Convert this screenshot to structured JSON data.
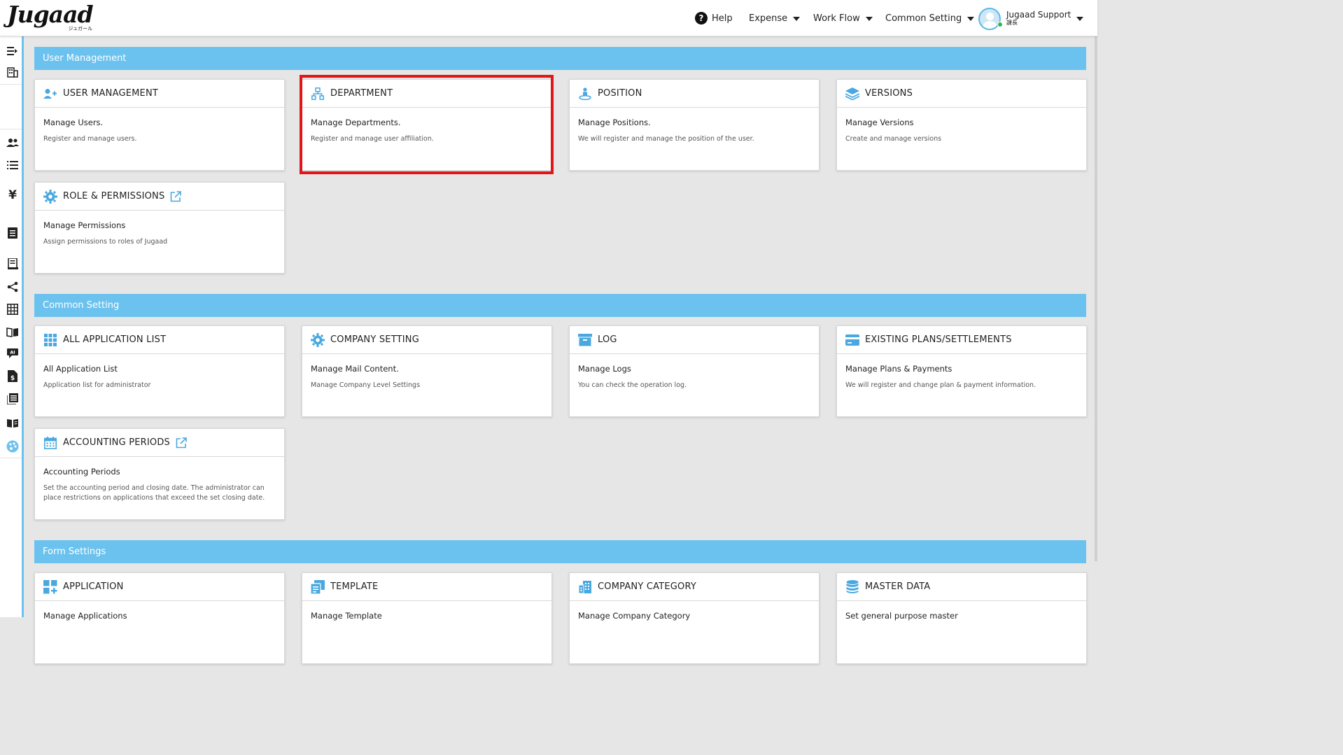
{
  "header": {
    "logo_text": "Jugaad",
    "logo_sub": "ジュガール",
    "nav": {
      "help": "Help",
      "expense": "Expense",
      "workflow": "Work Flow",
      "common_setting": "Common Setting"
    },
    "user": {
      "name": "Jugaad Support",
      "role": "課長"
    }
  },
  "sections": {
    "user_management": {
      "title": "User Management",
      "cards": {
        "user_management": {
          "title": "USER MANAGEMENT",
          "main": "Manage Users.",
          "desc": "Register and manage users."
        },
        "department": {
          "title": "DEPARTMENT",
          "main": "Manage Departments.",
          "desc": "Register and manage user affiliation."
        },
        "position": {
          "title": "POSITION",
          "main": "Manage Positions.",
          "desc": "We will register and manage the position of the user."
        },
        "versions": {
          "title": "VERSIONS",
          "main": "Manage Versions",
          "desc": "Create and manage versions"
        },
        "roles": {
          "title": "ROLE & PERMISSIONS",
          "main": "Manage Permissions",
          "desc": "Assign permissions to roles of Jugaad"
        }
      }
    },
    "common_setting": {
      "title": "Common Setting",
      "cards": {
        "all_apps": {
          "title": "ALL APPLICATION LIST",
          "main": "All Application List",
          "desc": "Application list for administrator"
        },
        "company_setting": {
          "title": "COMPANY SETTING",
          "main": "Manage Mail Content.",
          "desc": "Manage Company Level Settings"
        },
        "log": {
          "title": "LOG",
          "main": "Manage Logs",
          "desc": "You can check the operation log."
        },
        "plans": {
          "title": "EXISTING PLANS/SETTLEMENTS",
          "main": "Manage Plans & Payments",
          "desc": "We will register and change plan & payment information."
        },
        "accounting": {
          "title": "ACCOUNTING PERIODS",
          "main": "Accounting Periods",
          "desc": "Set the accounting period and closing date. The administrator can place restrictions on applications that exceed the set closing date."
        }
      }
    },
    "form_settings": {
      "title": "Form Settings",
      "cards": {
        "application": {
          "title": "APPLICATION",
          "main": "Manage Applications"
        },
        "template": {
          "title": "TEMPLATE",
          "main": "Manage Template"
        },
        "company_category": {
          "title": "COMPANY CATEGORY",
          "main": "Manage Company Category"
        },
        "master_data": {
          "title": "MASTER DATA",
          "main": "Set general purpose master"
        }
      }
    }
  },
  "colors": {
    "accent": "#6cc2ee",
    "icon_blue": "#4aa8e0",
    "highlight": "#e0161b",
    "background": "#e6e6e6"
  },
  "icons": {
    "rail": [
      "menu-expand-icon",
      "building-icon",
      "users-icon",
      "list-icon",
      "yen-icon",
      "document-icon",
      "receipt-icon",
      "share-icon",
      "grid-icon",
      "book-icon",
      "ai-chat-icon",
      "invoice-icon",
      "reports-icon",
      "manual-icon",
      "palette-icon"
    ]
  }
}
